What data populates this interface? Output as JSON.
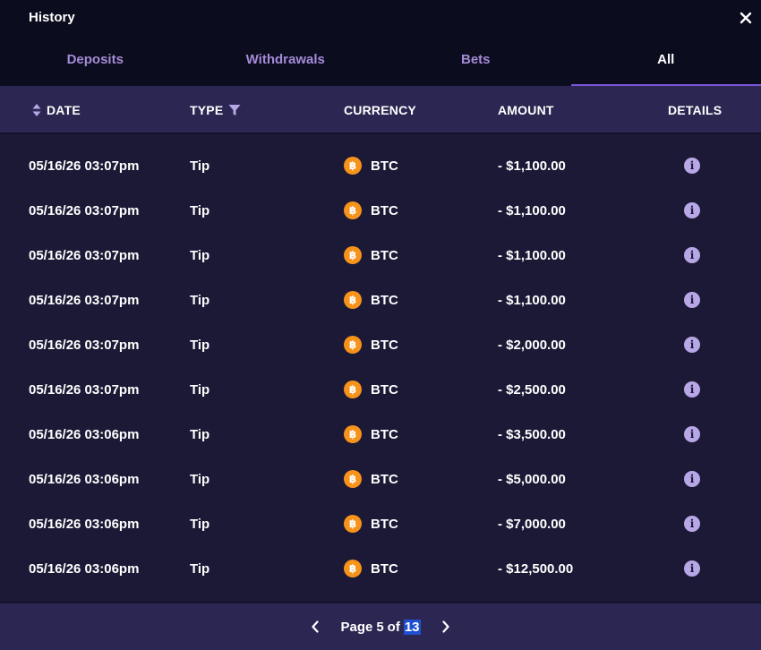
{
  "window": {
    "title": "History"
  },
  "tabs": [
    {
      "label": "Deposits",
      "active": false
    },
    {
      "label": "Withdrawals",
      "active": false
    },
    {
      "label": "Bets",
      "active": false
    },
    {
      "label": "All",
      "active": true
    }
  ],
  "table": {
    "columns": {
      "date": "DATE",
      "type": "TYPE",
      "currency": "CURRENCY",
      "amount": "AMOUNT",
      "details": "DETAILS"
    },
    "rows": [
      {
        "date": "05/16/26 03:07pm",
        "type": "Tip",
        "currency": "BTC",
        "amount": "- $1,100.00"
      },
      {
        "date": "05/16/26 03:07pm",
        "type": "Tip",
        "currency": "BTC",
        "amount": "- $1,100.00"
      },
      {
        "date": "05/16/26 03:07pm",
        "type": "Tip",
        "currency": "BTC",
        "amount": "- $1,100.00"
      },
      {
        "date": "05/16/26 03:07pm",
        "type": "Tip",
        "currency": "BTC",
        "amount": "- $1,100.00"
      },
      {
        "date": "05/16/26 03:07pm",
        "type": "Tip",
        "currency": "BTC",
        "amount": "- $2,000.00"
      },
      {
        "date": "05/16/26 03:07pm",
        "type": "Tip",
        "currency": "BTC",
        "amount": "- $2,500.00"
      },
      {
        "date": "05/16/26 03:06pm",
        "type": "Tip",
        "currency": "BTC",
        "amount": "- $3,500.00"
      },
      {
        "date": "05/16/26 03:06pm",
        "type": "Tip",
        "currency": "BTC",
        "amount": "- $5,000.00"
      },
      {
        "date": "05/16/26 03:06pm",
        "type": "Tip",
        "currency": "BTC",
        "amount": "- $7,000.00"
      },
      {
        "date": "05/16/26 03:06pm",
        "type": "Tip",
        "currency": "BTC",
        "amount": "- $12,500.00"
      }
    ]
  },
  "pagination": {
    "prefix": "Page",
    "current": "5",
    "of": "of",
    "total": "13"
  },
  "icons": {
    "close": "close-icon",
    "sort": "sort-icon",
    "filter": "filter-icon",
    "currency": "bitcoin-icon",
    "details": "info-icon",
    "prev": "chevron-left-icon",
    "next": "chevron-right-icon"
  },
  "colors": {
    "background": "#1b1936",
    "header_bg": "#0b0c1d",
    "table_head_bg": "#2c2752",
    "tab_inactive": "#a58bd8",
    "tab_underline": "#7a55d6",
    "btc": "#f7931a",
    "info": "#b8a7e6",
    "selection": "#1e4fd0"
  }
}
